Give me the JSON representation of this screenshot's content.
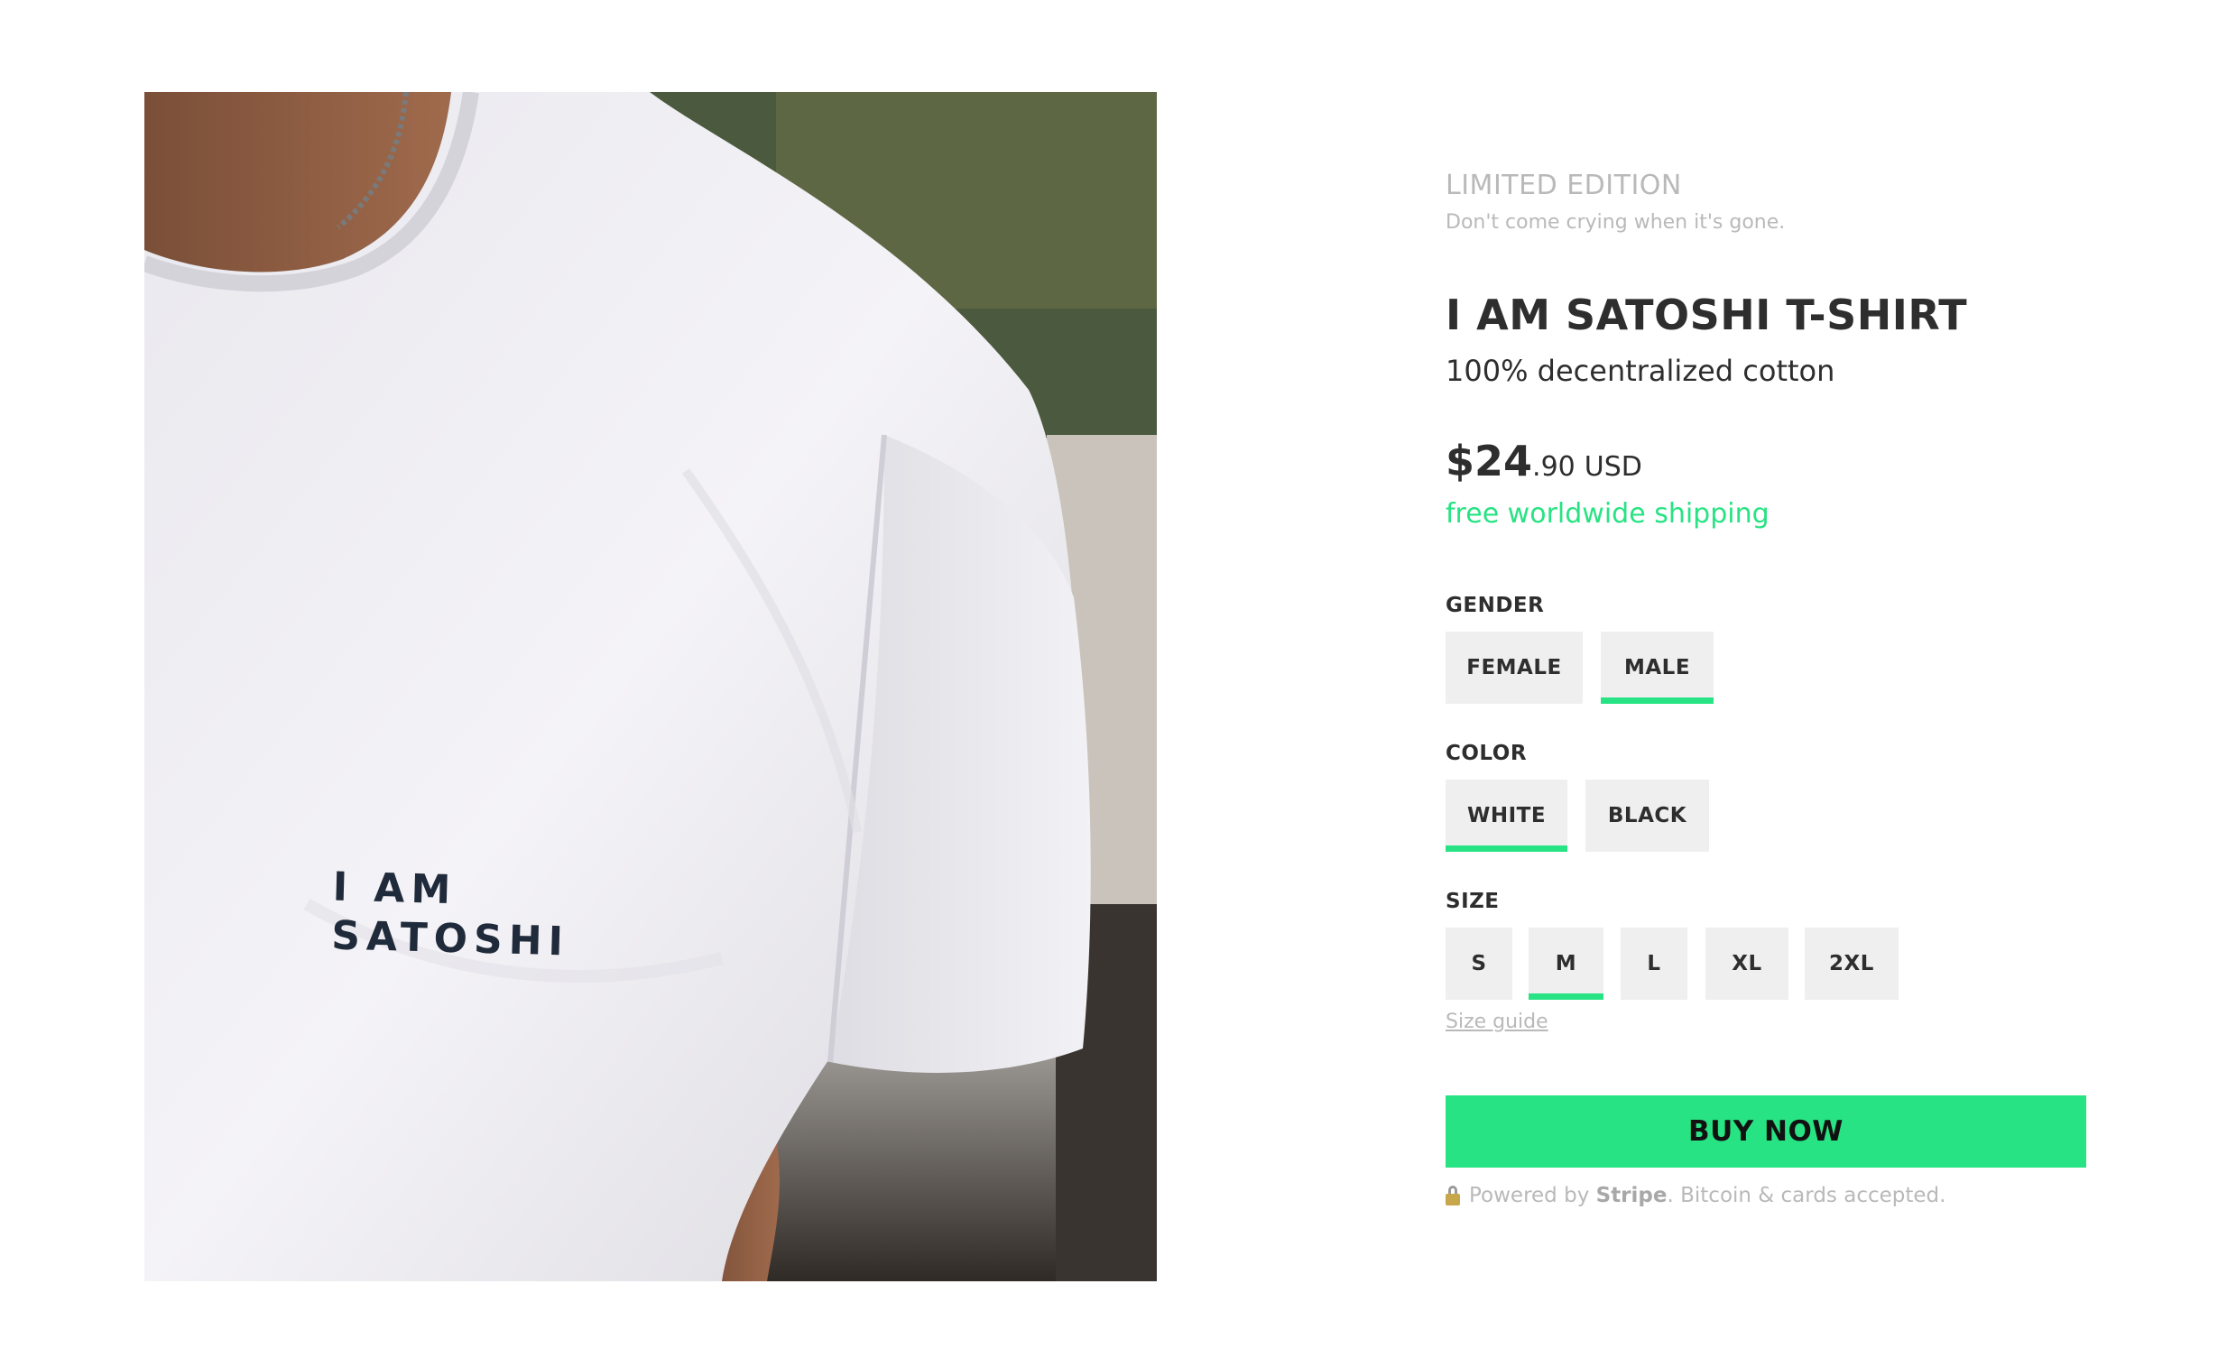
{
  "product_image": {
    "print_line1": "I AM",
    "print_line2": "SATOSHI"
  },
  "eyebrow": {
    "label": "LIMITED EDITION",
    "sub": "Don't come crying when it's gone."
  },
  "product": {
    "title": "I AM SATOSHI T-SHIRT",
    "subtitle": "100% decentralized cotton"
  },
  "price": {
    "whole": "$24",
    "cents": ".90",
    "currency": "USD",
    "shipping": "free worldwide shipping"
  },
  "options": {
    "gender": {
      "label": "GENDER",
      "choices": [
        "FEMALE",
        "MALE"
      ],
      "selected": "MALE"
    },
    "color": {
      "label": "COLOR",
      "choices": [
        "WHITE",
        "BLACK"
      ],
      "selected": "WHITE"
    },
    "size": {
      "label": "SIZE",
      "choices": [
        "S",
        "M",
        "L",
        "XL",
        "2XL"
      ],
      "selected": "M",
      "guide_link": "Size guide"
    }
  },
  "buy_button": "BUY NOW",
  "footer": {
    "icon": "lock-icon",
    "prefix": "Powered by ",
    "brand": "Stripe",
    "suffix": ". Bitcoin & cards accepted."
  },
  "colors": {
    "accent": "#27e383",
    "option_bg": "#efefef",
    "muted": "#b9b9b9",
    "text": "#2e2e2e"
  }
}
